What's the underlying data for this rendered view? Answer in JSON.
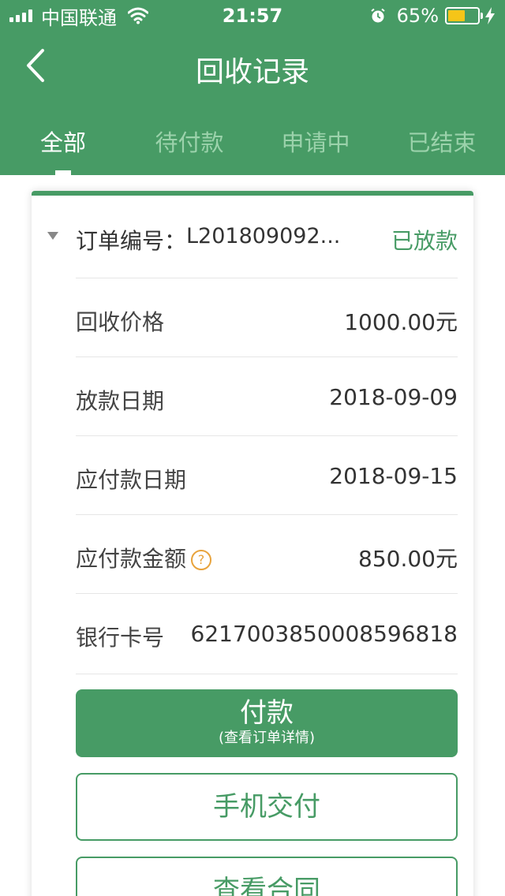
{
  "status_bar": {
    "carrier": "中国联通",
    "time": "21:57",
    "battery_percent": "65%",
    "battery_level": 0.65
  },
  "nav": {
    "title": "回收记录",
    "back_icon": "chevron-left-icon"
  },
  "tabs": [
    {
      "label": "全部",
      "active": true
    },
    {
      "label": "待付款",
      "active": false
    },
    {
      "label": "申请中",
      "active": false
    },
    {
      "label": "已结束",
      "active": false
    }
  ],
  "order": {
    "number_label": "订单编号：",
    "number": "L201809092...",
    "status": "已放款",
    "rows": [
      {
        "label": "回收价格",
        "value": "1000.00元"
      },
      {
        "label": "放款日期",
        "value": "2018-09-09"
      },
      {
        "label": "应付款日期",
        "value": "2018-09-15"
      },
      {
        "label": "应付款金额",
        "value": "850.00元"
      },
      {
        "label": "银行卡号",
        "value": "6217003850008596818"
      }
    ],
    "help_icon_glyph": "?",
    "pay_button": {
      "label": "付款",
      "sub_label": "(查看订单详情)"
    },
    "phone_delivery_button": "手机交付",
    "view_contract_button": "查看合同"
  },
  "colors": {
    "brand_green": "#479b65",
    "inactive_tab": "#9bd2ab",
    "help_orange": "#e8a33c",
    "battery_yellow": "#f5c518"
  }
}
